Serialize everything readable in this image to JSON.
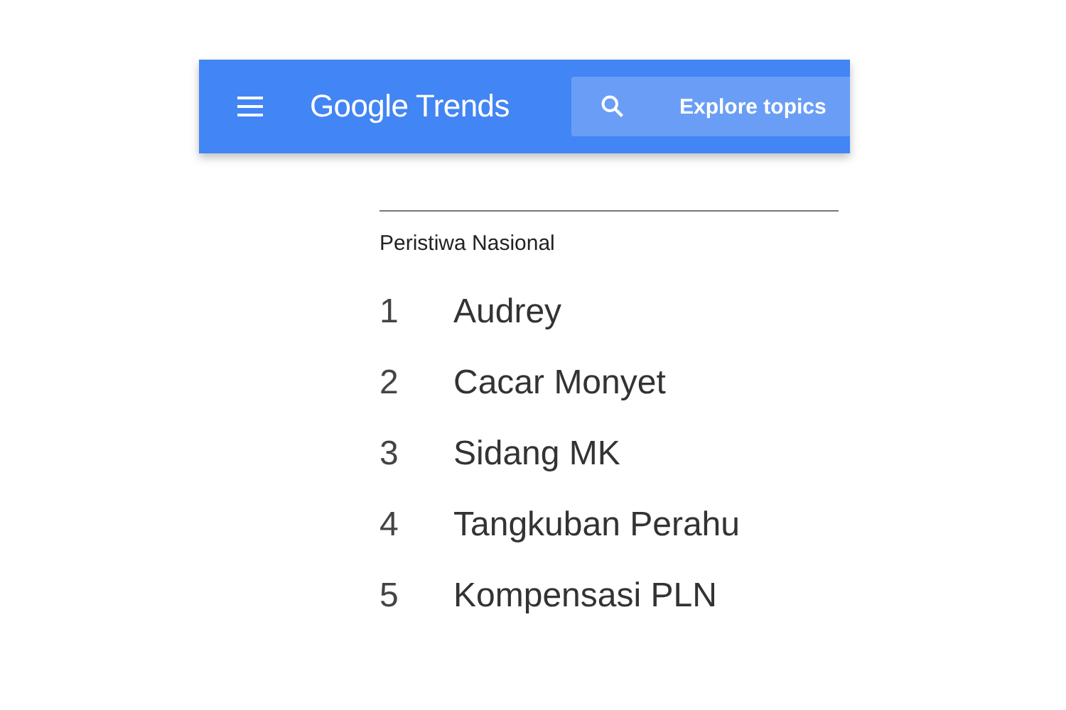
{
  "header": {
    "brand": "Google Trends",
    "search": {
      "placeholder": "Explore topics"
    }
  },
  "section": {
    "title": "Peristiwa Nasional",
    "items": [
      {
        "rank": "1",
        "label": "Audrey"
      },
      {
        "rank": "2",
        "label": "Cacar Monyet"
      },
      {
        "rank": "3",
        "label": "Sidang MK"
      },
      {
        "rank": "4",
        "label": "Tangkuban Perahu"
      },
      {
        "rank": "5",
        "label": "Kompensasi PLN"
      }
    ]
  }
}
